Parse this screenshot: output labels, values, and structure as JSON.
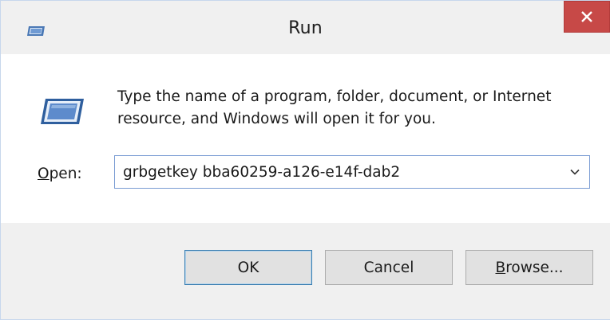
{
  "window": {
    "title": "Run",
    "close_symbol": "×",
    "title_icon": "run-icon"
  },
  "content": {
    "icon": "run-icon",
    "description": "Type the name of a program, folder, document, or Internet resource, and Windows will open it for you.",
    "open_label_accel": "O",
    "open_label_rest": "pen:",
    "open_value": "grbgetkey bba60259-a126-e14f-dab2"
  },
  "buttons": {
    "ok": "OK",
    "cancel": "Cancel",
    "browse_accel": "B",
    "browse_rest": "rowse..."
  },
  "colors": {
    "close_bg": "#c74947",
    "chrome_bg": "#f0f0f0",
    "default_button_border": "#3c7fb1"
  }
}
